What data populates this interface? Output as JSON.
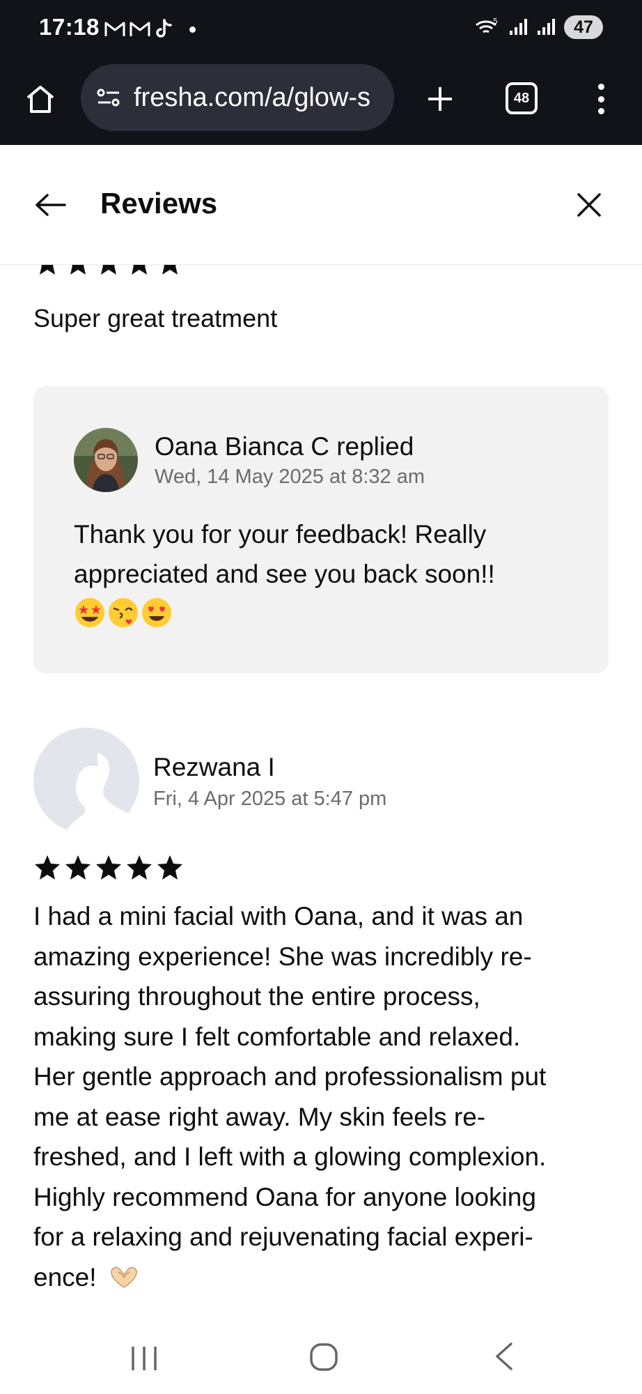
{
  "status_bar": {
    "time": "17:18",
    "battery": "47",
    "notification_icons": [
      "gmail-icon",
      "gmail-icon",
      "tiktok-icon"
    ]
  },
  "browser": {
    "url": "fresha.com/a/glow-s",
    "tab_count": "48"
  },
  "header": {
    "title": "Reviews"
  },
  "reviews": [
    {
      "rating": 5,
      "text": "Super great treatment",
      "reply": {
        "name": "Oana Bianca C replied",
        "date": "Wed, 14 May 2025 at 8:32 am",
        "text_line1": "Thank you for your feedback! Really",
        "text_line2": "appreciated and see you back soon!!",
        "emojis": [
          "star-struck-emoji",
          "face-blowing-kiss-emoji",
          "heart-eyes-emoji"
        ]
      }
    },
    {
      "name": "Rezwana I",
      "date": "Fri, 4 Apr 2025 at 5:47 pm",
      "rating": 5,
      "text_lines": [
        "I had a mini facial with Oana, and it was an",
        "amazing experience! She was incredibly re-",
        "assuring throughout the entire process,",
        "making sure I felt comfortable and relaxed.",
        "Her gentle approach and professionalism put",
        "me at ease right away. My skin feels re-",
        "freshed, and I left with a glowing complexion.",
        "Highly recommend Oana for anyone looking",
        "for a relaxing and rejuvenating facial experi-",
        "ence!"
      ],
      "trailing_emoji": "heart-hands-emoji"
    }
  ],
  "colors": {
    "system_bar": "#121318",
    "url_pill": "#2c2f3a",
    "reply_background": "#f2f2f2",
    "secondary_text": "#6b6b6b",
    "star": "#0d0d0d"
  }
}
